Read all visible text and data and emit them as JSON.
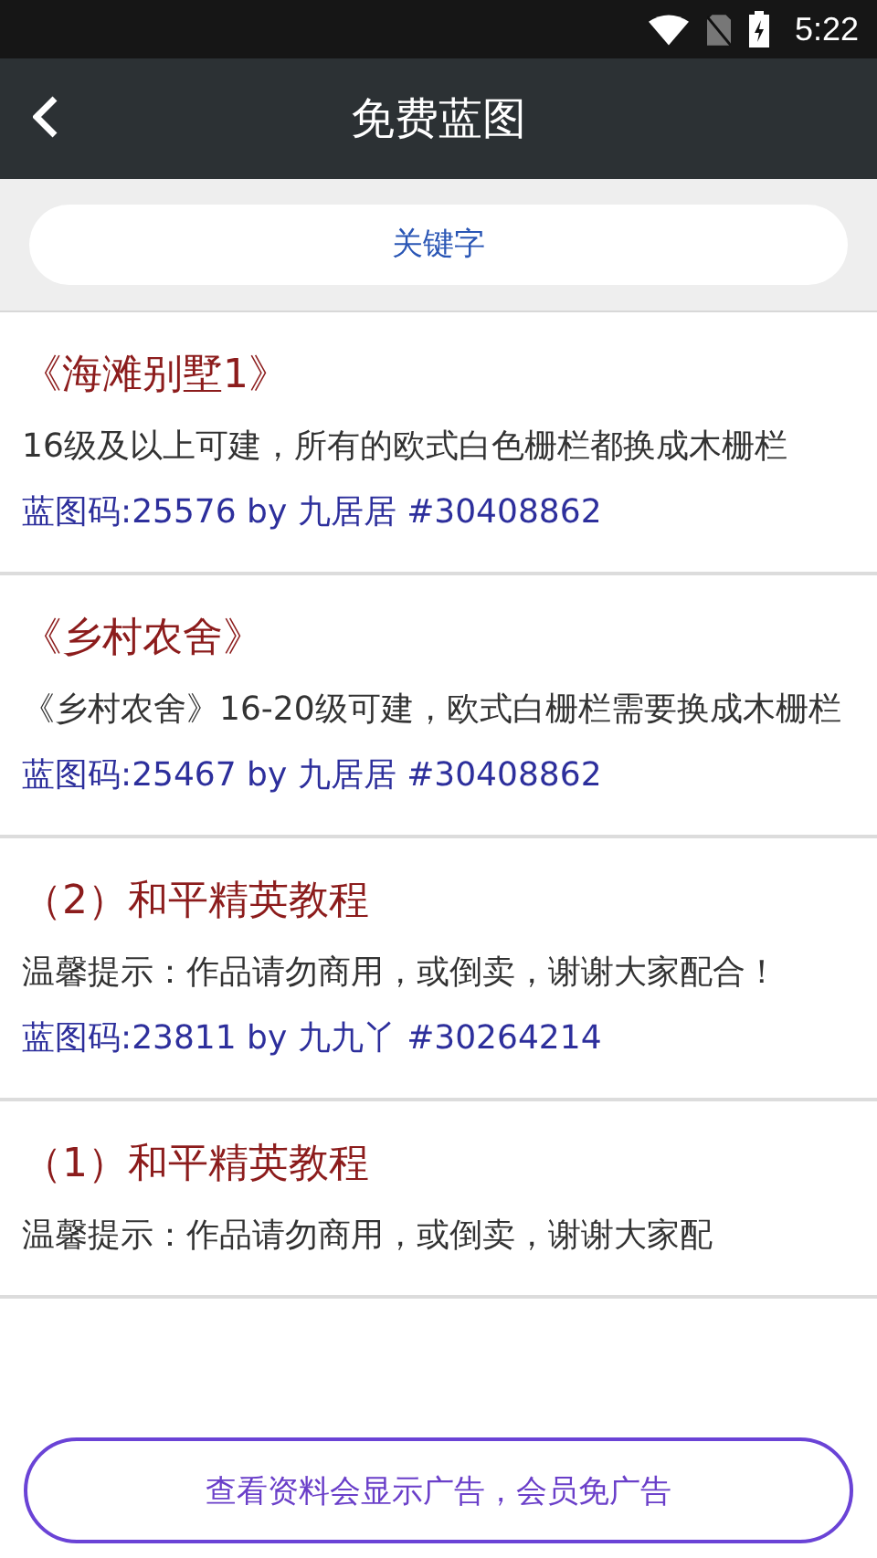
{
  "status_bar": {
    "time": "5:22"
  },
  "header": {
    "title": "免费蓝图"
  },
  "search": {
    "placeholder": "关键字"
  },
  "items": [
    {
      "title": "《海滩别墅1》",
      "description": "16级及以上可建，所有的欧式白色栅栏都换成木栅栏",
      "code": "蓝图码:25576 by 九居居 #30408862"
    },
    {
      "title": "《乡村农舍》",
      "description": "《乡村农舍》16-20级可建，欧式白栅栏需要换成木栅栏",
      "code": "蓝图码:25467 by 九居居 #30408862"
    },
    {
      "title": "（2）和平精英教程",
      "description": "温馨提示：作品请勿商用，或倒卖，谢谢大家配合！",
      "code": "蓝图码:23811 by 九九丫 #30264214"
    },
    {
      "title": "（1）和平精英教程",
      "description": "温馨提示：作品请勿商用，或倒卖，谢谢大家配"
    }
  ],
  "ad_notice": {
    "label": "查看资料会显示广告，会员免广告"
  }
}
